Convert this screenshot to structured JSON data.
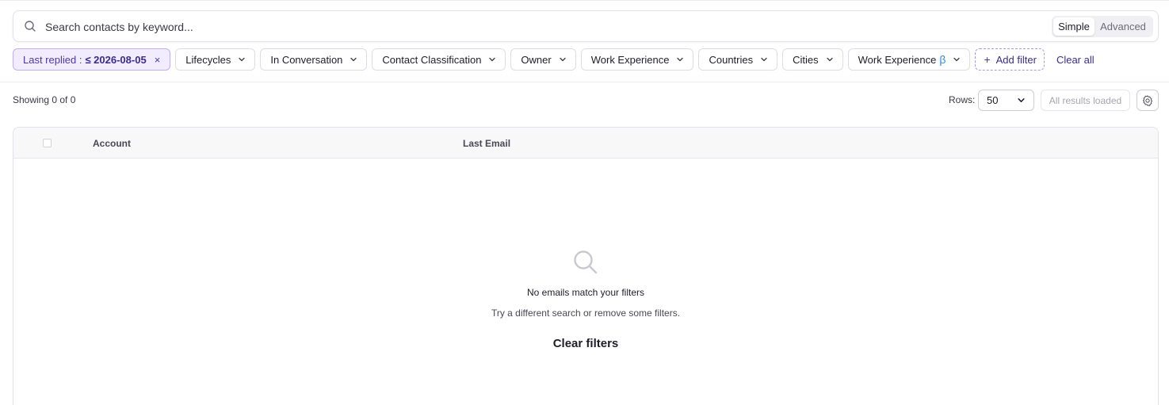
{
  "search": {
    "placeholder": "Search contacts by keyword...",
    "value": "",
    "modes": {
      "simple": "Simple",
      "advanced": "Advanced",
      "selected": "Simple"
    }
  },
  "filters": {
    "active": {
      "label": "Last replied :",
      "value": "≤ 2026-08-05",
      "remove_icon": "×"
    },
    "chips": [
      {
        "label": "Lifecycles"
      },
      {
        "label": "In Conversation"
      },
      {
        "label": "Contact Classification"
      },
      {
        "label": "Owner"
      },
      {
        "label": "Work Experience"
      },
      {
        "label": "Countries"
      },
      {
        "label": "Cities"
      },
      {
        "label": "Work Experience",
        "badge": "β"
      }
    ],
    "add_label": "Add filter",
    "add_icon": "+",
    "clear_all": "Clear all"
  },
  "results": {
    "showing": "Showing 0 of 0",
    "rows_label": "Rows:",
    "rows_value": "50",
    "loaded_label": "All results loaded"
  },
  "table": {
    "columns": {
      "account": "Account",
      "last_email": "Last Email"
    },
    "rows": []
  },
  "empty_state": {
    "icon": "search-icon",
    "title": "No emails match your filters",
    "subtitle": "Try a different search or remove some filters.",
    "action": "Clear filters"
  },
  "colors": {
    "accent": "#3a2d8a",
    "active_chip_bg": "#f1ecfe",
    "beta": "#2f8de4"
  }
}
